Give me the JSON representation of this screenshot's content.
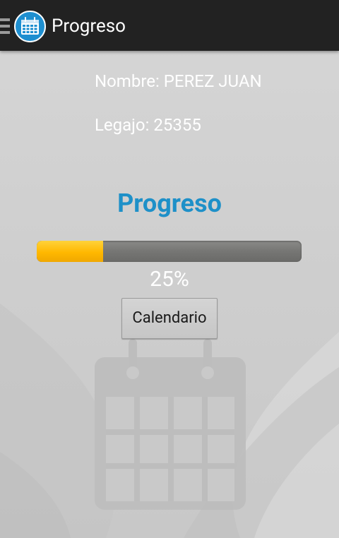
{
  "actionbar": {
    "title": "Progreso",
    "menu_icon": "hamburger-menu-icon",
    "app_icon": "calendar-app-icon"
  },
  "student": {
    "name_label": "Nombre:",
    "name_value": "PEREZ JUAN",
    "legajo_label": "Legajo:",
    "legajo_value": "25355"
  },
  "progress": {
    "heading": "Progreso",
    "value_percent": 25,
    "percent_text": "25%"
  },
  "actions": {
    "calendar_button_label": "Calendario"
  },
  "colors": {
    "actionbar_bg": "#222222",
    "accent_blue": "#1e90c8",
    "progress_fill": "#ffb800",
    "progress_track": "#767674",
    "background": "#cfcfcf"
  },
  "decor": {
    "watermark_icon": "calendar-watermark-icon"
  }
}
